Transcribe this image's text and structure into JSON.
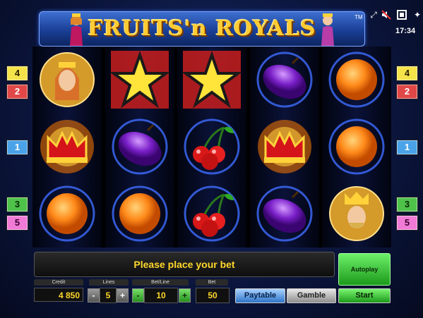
{
  "header": {
    "title": "FRUITS'n ROYALS",
    "tm": "TM"
  },
  "clock": "17:34",
  "top_icons": [
    "resize-icon",
    "sound-off-icon",
    "fullscreen-icon",
    "settings-icon"
  ],
  "left_lines": [
    "4",
    "2",
    "1",
    "3",
    "5"
  ],
  "right_lines": [
    "4",
    "2",
    "1",
    "3",
    "5"
  ],
  "reels": [
    [
      "queen",
      "crown",
      "orange"
    ],
    [
      "star",
      "plum",
      "orange"
    ],
    [
      "star",
      "cherry",
      "cherry"
    ],
    [
      "plum",
      "crown",
      "plum"
    ],
    [
      "orange",
      "orange",
      "king"
    ]
  ],
  "message": "Please place your bet",
  "autoplay_label": "Autoplay",
  "credit": {
    "label": "Credit",
    "value": "4 850"
  },
  "lines": {
    "label": "Lines",
    "value": "5",
    "minus": "-",
    "plus": "+"
  },
  "bet_line": {
    "label": "Bet/Line",
    "value": "10",
    "minus": "-",
    "plus": "+"
  },
  "bet": {
    "label": "Bet",
    "value": "50"
  },
  "paytable_label": "Paytable",
  "gamble_label": "Gamble",
  "start_label": "Start",
  "colors": {
    "star_bg": "#c81e1e",
    "reel_glow": "#3f6dff",
    "accent_gold": "#ffcc33"
  }
}
